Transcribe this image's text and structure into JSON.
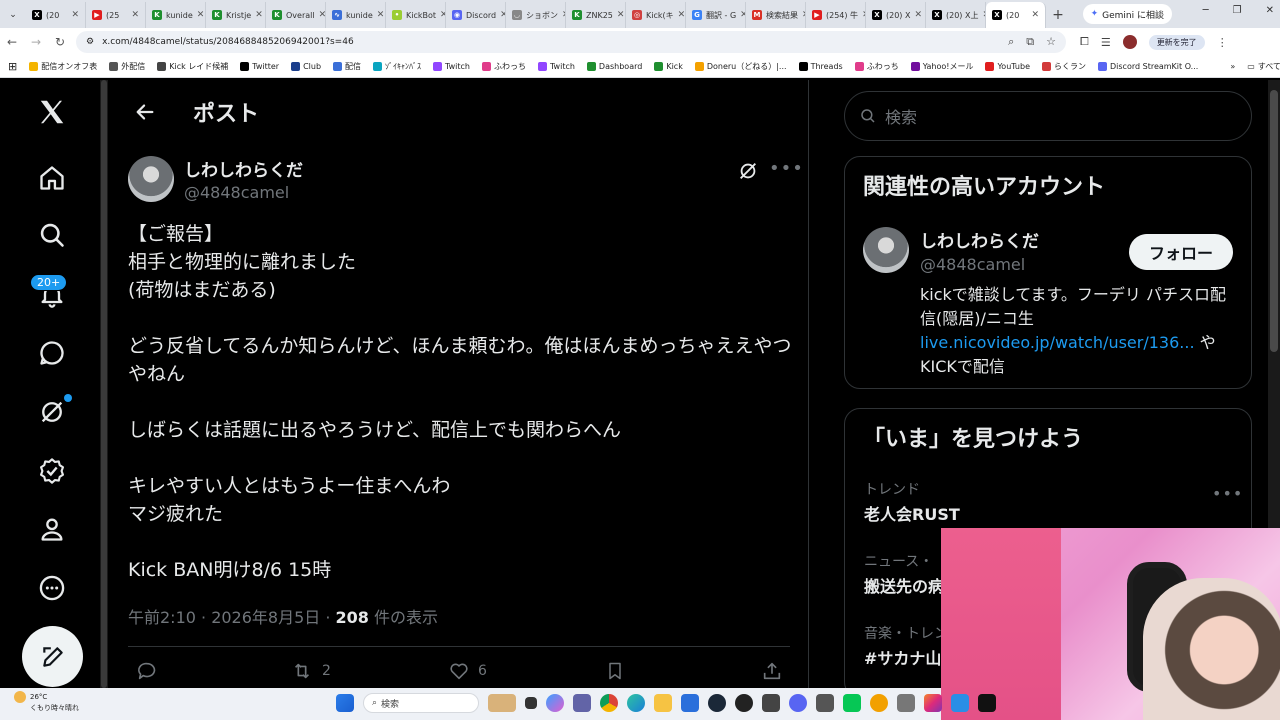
{
  "browser": {
    "tabs": [
      {
        "label": "(20",
        "color": "#000000",
        "glyph": "X"
      },
      {
        "label": "(25",
        "color": "#e01e1e",
        "glyph": "▶"
      },
      {
        "label": "kunide",
        "color": "#1f8f2f",
        "glyph": "K"
      },
      {
        "label": "Kristje",
        "color": "#1f8f2f",
        "glyph": "K"
      },
      {
        "label": "Overall",
        "color": "#1f8f2f",
        "glyph": "K"
      },
      {
        "label": "kunide",
        "color": "#3b6fd8",
        "glyph": "∿"
      },
      {
        "label": "KickBot",
        "color": "#9acd32",
        "glyph": "•"
      },
      {
        "label": "Discord",
        "color": "#5865f2",
        "glyph": "◉"
      },
      {
        "label": "ショボン",
        "color": "#888888",
        "glyph": "◡"
      },
      {
        "label": "ZNK25",
        "color": "#1f8f2f",
        "glyph": "K"
      },
      {
        "label": "Kick(キ",
        "color": "#d04040",
        "glyph": "◎"
      },
      {
        "label": "翻訳 - G",
        "color": "#3b82f6",
        "glyph": "G"
      },
      {
        "label": "検索結果",
        "color": "#d93025",
        "glyph": "M"
      },
      {
        "label": "(254) 牛",
        "color": "#e01e1e",
        "glyph": "▶"
      },
      {
        "label": "(20) X",
        "color": "#000000",
        "glyph": "X"
      },
      {
        "label": "(20) X上",
        "color": "#000000",
        "glyph": "X"
      },
      {
        "label": "(20",
        "color": "#000000",
        "glyph": "X"
      }
    ],
    "gemini_label": "Gemini に相談",
    "url": "x.com/4848camel/status/2084688485206942001?s=46",
    "update_label": "更新を完了",
    "bookmarks": [
      {
        "label": "配信オンオフ表",
        "color": "#f4b400"
      },
      {
        "label": "外配信",
        "color": "#555555"
      },
      {
        "label": "Kick レイド候補",
        "color": "#444444"
      },
      {
        "label": "Twitter",
        "color": "#000000"
      },
      {
        "label": "Club",
        "color": "#1a3e8c"
      },
      {
        "label": "配信",
        "color": "#3b6fd8"
      },
      {
        "label": "ｿﾞｲｷｬﾝﾊﾞｽ",
        "color": "#0aa5c0"
      },
      {
        "label": "Twitch",
        "color": "#9146ff"
      },
      {
        "label": "ふわっち",
        "color": "#e03c8a"
      },
      {
        "label": "Twitch",
        "color": "#9146ff"
      },
      {
        "label": "Dashboard",
        "color": "#1f8f2f"
      },
      {
        "label": "Kick",
        "color": "#1f8f2f"
      },
      {
        "label": "Doneru（どねる）|...",
        "color": "#f4a100"
      },
      {
        "label": "Threads",
        "color": "#000000"
      },
      {
        "label": "ふわっち",
        "color": "#e03c8a"
      },
      {
        "label": "Yahoo!メール",
        "color": "#720e9e"
      },
      {
        "label": "YouTube",
        "color": "#e01e1e"
      },
      {
        "label": "らくラン",
        "color": "#d23a3a"
      },
      {
        "label": "Discord StreamKit O...",
        "color": "#5865f2"
      }
    ],
    "all_bookmarks_label": "すべてのブックマーク"
  },
  "x": {
    "header_title": "ポスト",
    "notification_count": "20+",
    "author": {
      "display_name": "しわしわらくだ",
      "handle": "@4848camel"
    },
    "tweet_lines": [
      "【ご報告】",
      "相手と物理的に離れました",
      "(荷物はまだある)",
      "",
      "どう反省してるんか知らんけど、ほんま頼むわ。俺はほんまめっちゃええやつやねん",
      "",
      "しばらくは話題に出るやろうけど、配信上でも関わらへん",
      "",
      "キレやすい人とはもうよー住まへんわ",
      "マジ疲れた",
      "",
      "Kick BAN明け8/6 15時"
    ],
    "meta": {
      "time": "午前2:10 · 2026年8月5日 · ",
      "views": "208",
      "views_label": " 件の表示"
    },
    "actions": {
      "retweets": "2",
      "likes": "6"
    },
    "search_placeholder": "検索",
    "related": {
      "title": "関連性の高いアカウント",
      "name": "しわしわらくだ",
      "handle": "@4848camel",
      "follow_label": "フォロー",
      "bio_text": "kickで雑談してます。フーデリ パチスロ配信(隠居)/ニコ生 ",
      "bio_link": "live.nicovideo.jp/watch/user/136...",
      "bio_tail": " や KICKで配信"
    },
    "trends": {
      "title": "「いま」を見つけよう",
      "items": [
        {
          "category": "トレンド",
          "title": "老人会RUST"
        },
        {
          "category": "ニュース・",
          "title": "搬送先の病"
        },
        {
          "category": "音楽・トレン",
          "title": "#サカナ山"
        }
      ]
    }
  },
  "taskbar": {
    "temperature": "26°C",
    "weather": "くもり時々晴れ",
    "search_label": "検索"
  }
}
